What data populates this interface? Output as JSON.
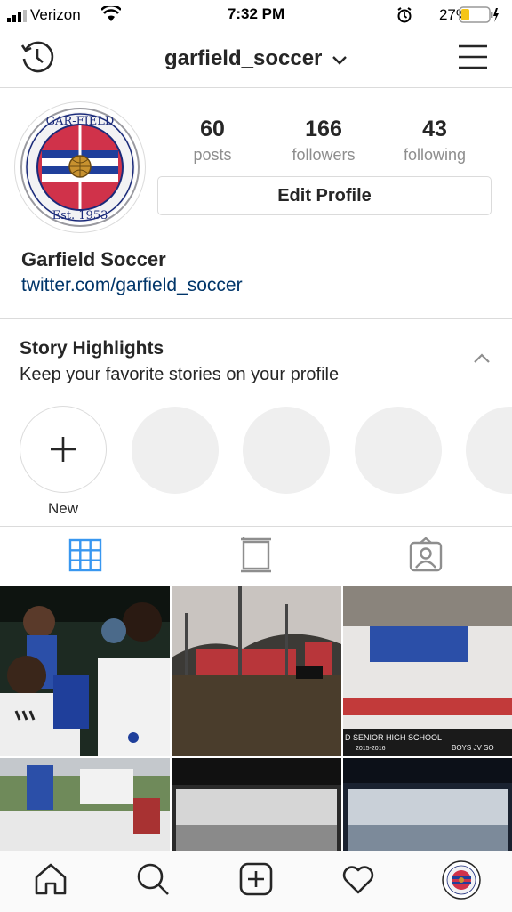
{
  "status": {
    "carrier": "Verizon",
    "time": "7:32 PM",
    "battery": "27%"
  },
  "header": {
    "username": "garfield_soccer"
  },
  "profile": {
    "avatar_text_top": "GAR-FIELD",
    "avatar_text_bottom": "Est. 1953",
    "posts": "60",
    "posts_label": "posts",
    "followers": "166",
    "followers_label": "followers",
    "following": "43",
    "following_label": "following",
    "edit_label": "Edit Profile",
    "full_name": "Garfield Soccer",
    "link": "twitter.com/garfield_soccer"
  },
  "highlights": {
    "title": "Story Highlights",
    "subtitle": "Keep your favorite stories on your profile",
    "new_label": "New"
  },
  "grid": {
    "photo3_caption_left": "D SENIOR HIGH SCHOOL",
    "photo3_caption_year": "2015-2016",
    "photo3_caption_right": "BOYS JV SO"
  },
  "icons": {
    "history": "history-icon",
    "dropdown": "chevron-down-icon",
    "menu": "hamburger-menu-icon",
    "grid": "grid-icon",
    "feed": "feed-icon",
    "tagged": "tagged-icon",
    "home": "home-icon",
    "search": "search-icon",
    "add": "add-post-icon",
    "activity": "heart-icon",
    "profile": "profile-avatar-icon"
  },
  "colors": {
    "link": "#003569",
    "accent": "#3897f0",
    "divider": "#dbdbdb",
    "battery": "#f5c518"
  }
}
